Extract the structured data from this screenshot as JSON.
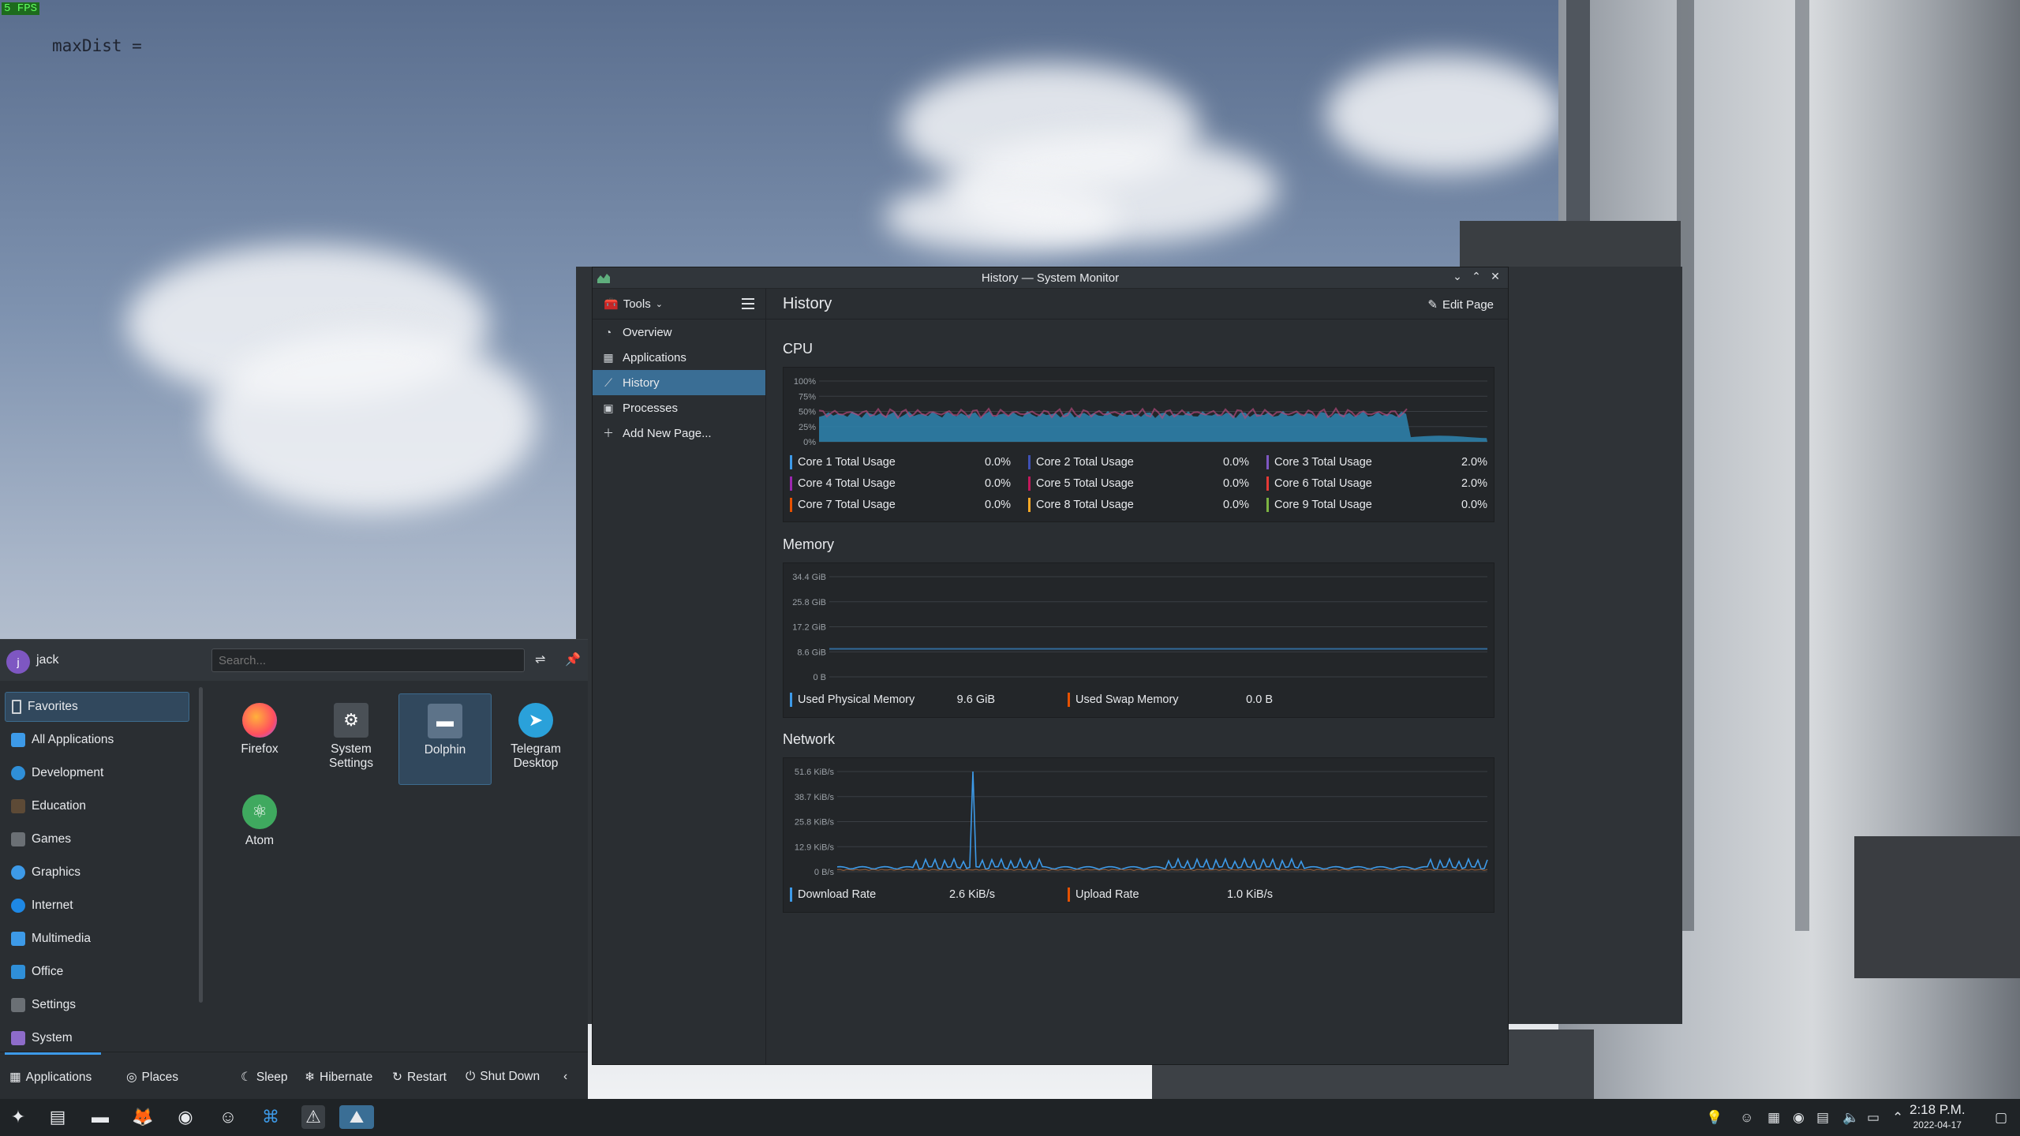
{
  "overlay": {
    "fps": "5 FPS",
    "debug_text": "maxDist ="
  },
  "window": {
    "title": "History — System Monitor",
    "controls": [
      "⌄",
      "⌃",
      "✕"
    ]
  },
  "sidebar": {
    "tools_label": "Tools",
    "items": [
      {
        "label": "Overview",
        "icon": "overview-icon"
      },
      {
        "label": "Applications",
        "icon": "applications-icon"
      },
      {
        "label": "History",
        "icon": "history-icon"
      },
      {
        "label": "Processes",
        "icon": "processes-icon"
      },
      {
        "label": "Add New Page...",
        "icon": "plus-icon"
      }
    ],
    "active": "History"
  },
  "page": {
    "title": "History",
    "edit_label": "Edit Page"
  },
  "cpu": {
    "title": "CPU",
    "y_ticks": [
      "100%",
      "75%",
      "50%",
      "25%",
      "0%"
    ],
    "legend": [
      {
        "label": "Core 1 Total Usage",
        "value": "0.0%",
        "color": "#3d9ae8"
      },
      {
        "label": "Core 2 Total Usage",
        "value": "0.0%",
        "color": "#3f51b5"
      },
      {
        "label": "Core 3 Total Usage",
        "value": "2.0%",
        "color": "#7e57c2"
      },
      {
        "label": "Core 4 Total Usage",
        "value": "0.0%",
        "color": "#9c27b0"
      },
      {
        "label": "Core 5 Total Usage",
        "value": "0.0%",
        "color": "#c2185b"
      },
      {
        "label": "Core 6 Total Usage",
        "value": "2.0%",
        "color": "#e53935"
      },
      {
        "label": "Core 7 Total Usage",
        "value": "0.0%",
        "color": "#e65100"
      },
      {
        "label": "Core 8 Total Usage",
        "value": "0.0%",
        "color": "#f9a825"
      },
      {
        "label": "Core 9 Total Usage",
        "value": "0.0%",
        "color": "#7cb342"
      }
    ]
  },
  "memory": {
    "title": "Memory",
    "y_ticks": [
      "34.4 GiB",
      "25.8 GiB",
      "17.2 GiB",
      "8.6 GiB",
      "0 B"
    ],
    "legend": [
      {
        "label": "Used Physical Memory",
        "value": "9.6 GiB",
        "color": "#3d9ae8"
      },
      {
        "label": "Used Swap Memory",
        "value": "0.0 B",
        "color": "#e65100"
      }
    ]
  },
  "network": {
    "title": "Network",
    "y_ticks": [
      "51.6 KiB/s",
      "38.7 KiB/s",
      "25.8 KiB/s",
      "12.9 KiB/s",
      "0 B/s"
    ],
    "legend": [
      {
        "label": "Download Rate",
        "value": "2.6 KiB/s",
        "color": "#3d9ae8"
      },
      {
        "label": "Upload Rate",
        "value": "1.0 KiB/s",
        "color": "#e65100"
      }
    ]
  },
  "launcher": {
    "user": "jack",
    "avatar_letter": "j",
    "search_placeholder": "Search...",
    "categories": [
      {
        "label": "Favorites",
        "color": "#2a2e32"
      },
      {
        "label": "All Applications",
        "color": "#3d9ae8"
      },
      {
        "label": "Development",
        "color": "#2f8fd8"
      },
      {
        "label": "Education",
        "color": "#5d4a36"
      },
      {
        "label": "Games",
        "color": "#6b7075"
      },
      {
        "label": "Graphics",
        "color": "#3d9ae8"
      },
      {
        "label": "Internet",
        "color": "#1e88e5"
      },
      {
        "label": "Multimedia",
        "color": "#3d9ae8"
      },
      {
        "label": "Office",
        "color": "#2f8fd8"
      },
      {
        "label": "Settings",
        "color": "#6b7075"
      },
      {
        "label": "System",
        "color": "#8e6cc9"
      }
    ],
    "favorites": [
      {
        "label": "Firefox",
        "icon": "firefox-icon",
        "color": "#ff7139"
      },
      {
        "label": "System Settings",
        "icon": "settings-icon",
        "color": "#4a5056"
      },
      {
        "label": "Dolphin",
        "icon": "folder-icon",
        "color": "#5d7389"
      },
      {
        "label": "Telegram Desktop",
        "icon": "telegram-icon",
        "color": "#2aa1da"
      },
      {
        "label": "Atom",
        "icon": "atom-icon",
        "color": "#3fa95f"
      }
    ],
    "footer": {
      "applications": "Applications",
      "places": "Places",
      "sleep": "Sleep",
      "hibernate": "Hibernate",
      "restart": "Restart",
      "shutdown": "Shut Down"
    }
  },
  "taskbar": {
    "clock_time": "2:18 P.M.",
    "clock_date": "2022-04-17"
  }
}
